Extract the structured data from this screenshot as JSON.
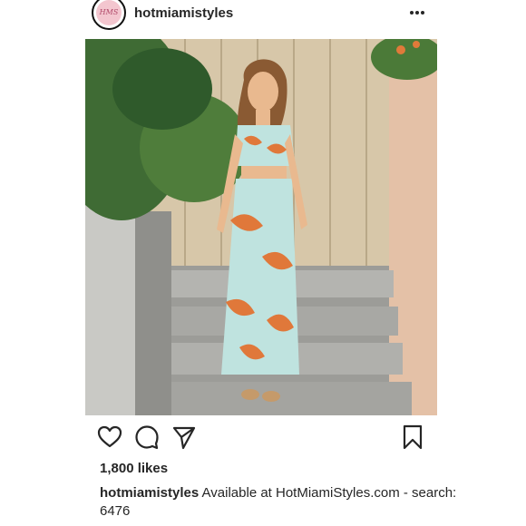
{
  "post": {
    "username": "hotmiamistyles",
    "avatar_text": "HMS",
    "likes": "1,800 likes",
    "caption_user": "hotmiamistyles",
    "caption_text": " Available at HotMiamiStyles.com - search: 6476",
    "icons": {
      "more": "more-options-icon",
      "like": "heart-icon",
      "comment": "comment-icon",
      "share": "share-icon",
      "save": "bookmark-icon"
    }
  }
}
